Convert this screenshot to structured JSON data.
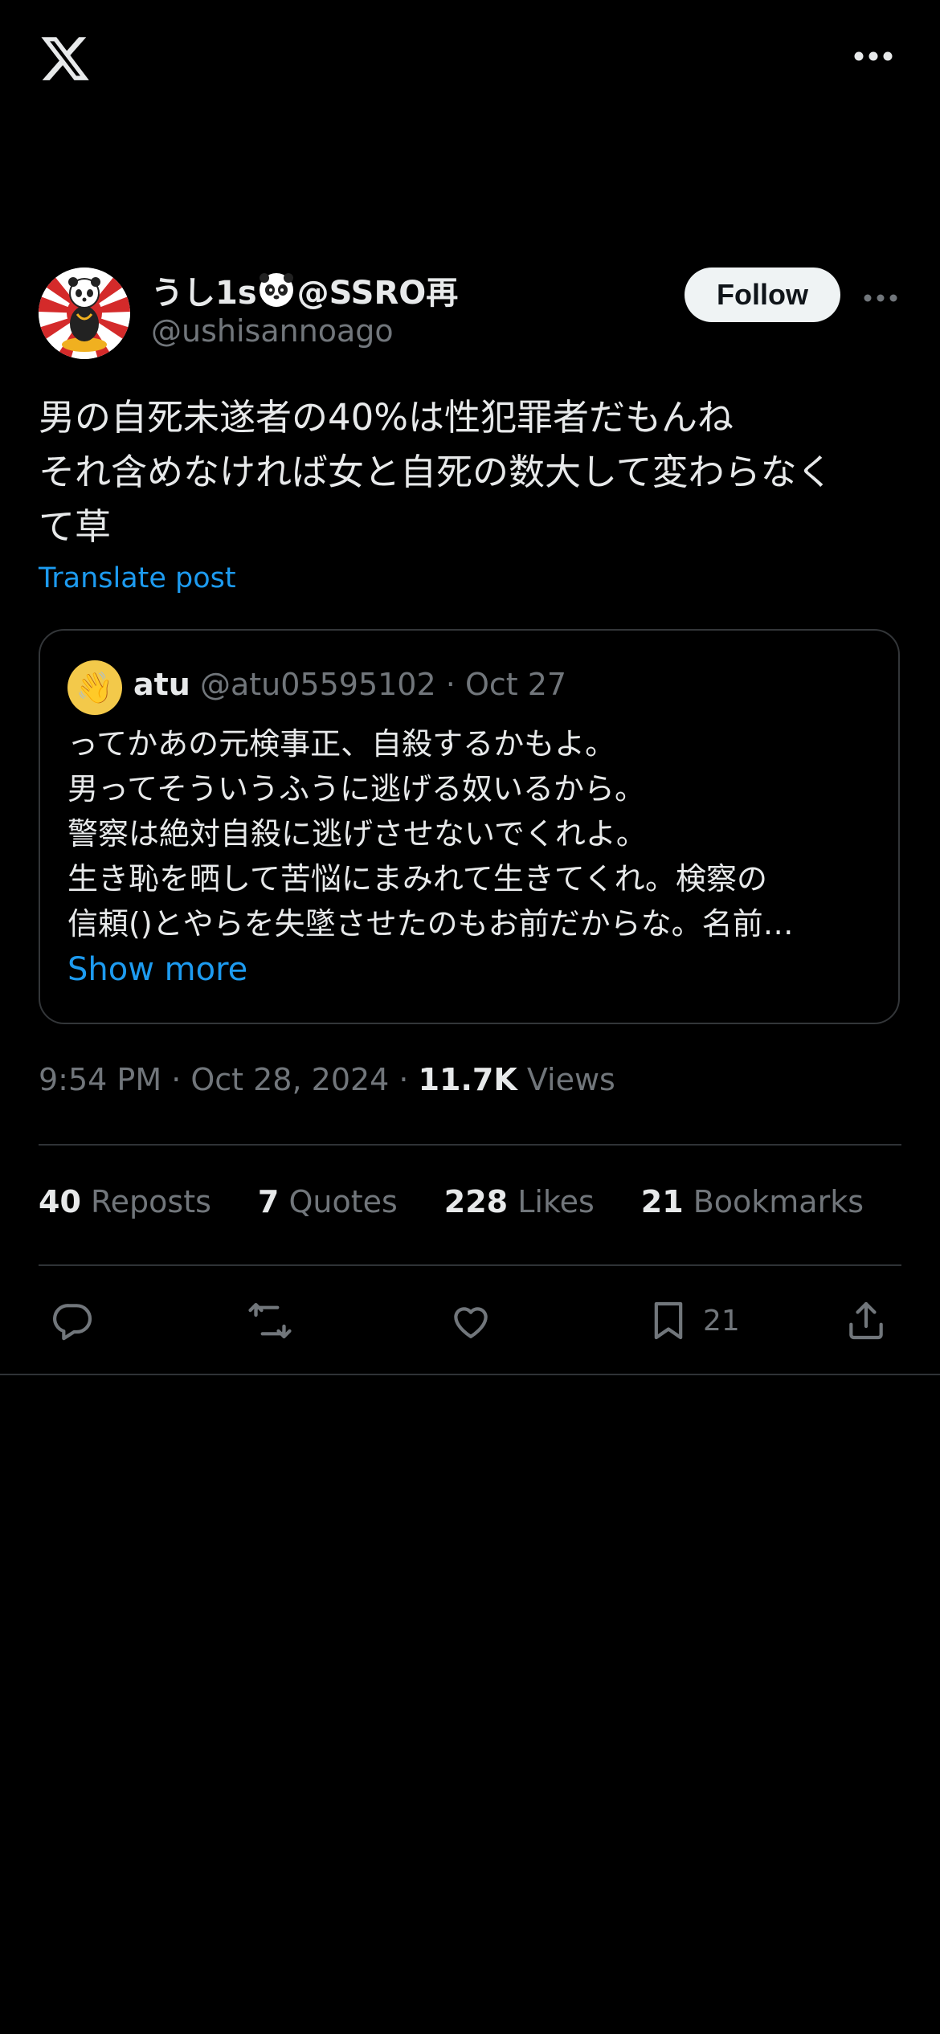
{
  "header": {
    "logo_icon": "x-logo-icon",
    "more_icon": "more-horizontal-icon"
  },
  "author": {
    "display_name_prefix": "うし1s",
    "display_name_suffix": "@SSRO再",
    "handle": "@ushisannoago",
    "follow_label": "Follow"
  },
  "post": {
    "lines": [
      "男の自死未遂者の40%は性犯罪者だもんね",
      "それ含めなければ女と自死の数大して変わらなく",
      "て草"
    ],
    "translate_label": "Translate post"
  },
  "quote": {
    "name": "atu",
    "handle": "@atu05595102",
    "dot": "·",
    "date": "Oct 27",
    "avatar_emoji": "👋",
    "lines": [
      "ってかあの元検事正、自殺するかもよ。",
      "男ってそういうふうに逃げる奴いるから。",
      "警察は絶対自殺に逃げさせないでくれよ。",
      "生き恥を晒して苦悩にまみれて生きてくれ。検察の",
      "信頼()とやらを失墜させたのもお前だからな。名前…"
    ],
    "show_more_label": "Show more"
  },
  "meta": {
    "time_date": "9:54 PM · Oct 28, 2024 · ",
    "views_count": "11.7K",
    "views_label": " Views"
  },
  "stats": [
    {
      "num": "40",
      "label": " Reposts"
    },
    {
      "num": "7",
      "label": " Quotes"
    },
    {
      "num": "228",
      "label": " Likes"
    },
    {
      "num": "21",
      "label": " Bookmarks"
    }
  ],
  "actions": {
    "bookmark_count": "21"
  },
  "colors": {
    "background": "#000000",
    "text": "#e7e9ea",
    "muted": "#71767b",
    "accent": "#1d9bf0",
    "border": "#2f3336"
  }
}
